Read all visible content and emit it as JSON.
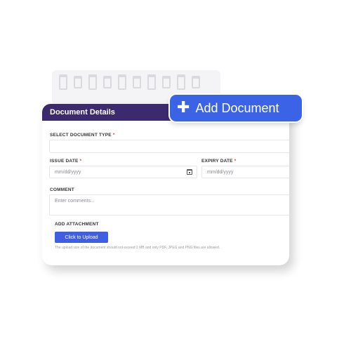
{
  "card": {
    "title": "Document Details"
  },
  "form": {
    "document_type": {
      "label": "SELECT DOCUMENT TYPE",
      "required_mark": "*",
      "value": ""
    },
    "issue_date": {
      "label": "ISSUE DATE",
      "required_mark": "*",
      "placeholder": "mm/dd/yyyy",
      "icon": "calendar-icon"
    },
    "expiry_date": {
      "label": "EXPIRY DATE",
      "required_mark": "*",
      "placeholder": "mm/dd/yyyy"
    },
    "comment": {
      "label": "COMMENT",
      "placeholder": "Enter comments..."
    },
    "attachment": {
      "label": "ADD ATTACHMENT",
      "button_label": "Click to Upload",
      "hint": "The upload size of the document should not exceed 2 MB and only PDF, JPEG and PNG files are allowed."
    }
  },
  "add_document": {
    "icon": "plus-icon",
    "label": "Add Document"
  },
  "colors": {
    "header": "#3b2b6e",
    "accent": "#3b63e6",
    "upload_button": "#3f5fe0",
    "required": "#e53935"
  }
}
